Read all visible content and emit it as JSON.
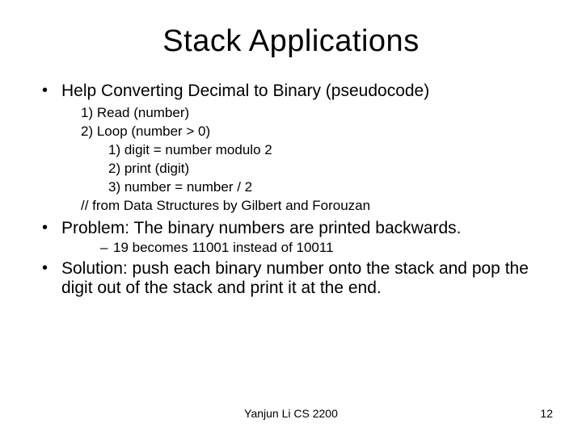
{
  "title": "Stack Applications",
  "bullets": {
    "help": "Help Converting Decimal to Binary (pseudocode)",
    "code": {
      "l1": "1) Read (number)",
      "l2": "2) Loop (number > 0)",
      "l3": "1) digit = number modulo 2",
      "l4": "2) print (digit)",
      "l5": "3) number = number / 2",
      "l6": "// from Data Structures by Gilbert and Forouzan"
    },
    "problem": "Problem: The binary numbers are printed backwards.",
    "problem_sub": "19 becomes 11001 instead of 10011",
    "solution": "Solution: push each binary number onto the stack and pop the digit out of the stack and print it at the end."
  },
  "footer": {
    "center": "Yanjun Li CS 2200",
    "page": "12"
  }
}
